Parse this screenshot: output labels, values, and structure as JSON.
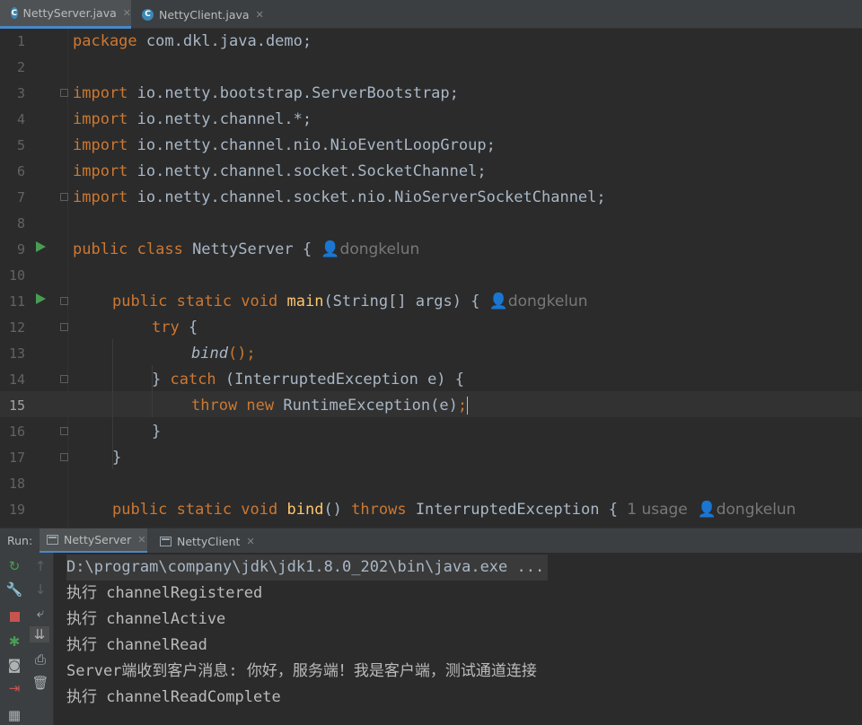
{
  "editor_tabs": [
    {
      "label": "NettyServer.java",
      "icon": "java-class-icon",
      "active": true
    },
    {
      "label": "NettyClient.java",
      "icon": "java-class-icon",
      "active": false
    }
  ],
  "code": {
    "current_line": 15,
    "lines": [
      {
        "n": "1"
      },
      {
        "n": "2"
      },
      {
        "n": "3"
      },
      {
        "n": "4"
      },
      {
        "n": "5"
      },
      {
        "n": "6"
      },
      {
        "n": "7"
      },
      {
        "n": "8"
      },
      {
        "n": "9"
      },
      {
        "n": "10"
      },
      {
        "n": "11"
      },
      {
        "n": "12"
      },
      {
        "n": "13"
      },
      {
        "n": "14"
      },
      {
        "n": "15"
      },
      {
        "n": "16"
      },
      {
        "n": "17"
      },
      {
        "n": "18"
      },
      {
        "n": "19"
      }
    ],
    "l1_kw": "package",
    "l1_rest": " com.dkl.java.demo;",
    "import_kw": "import",
    "imports": [
      " io.netty.bootstrap.ServerBootstrap;",
      " io.netty.channel.*;",
      " io.netty.channel.nio.NioEventLoopGroup;",
      " io.netty.channel.socket.SocketChannel;",
      " io.netty.channel.socket.nio.NioServerSocketChannel;"
    ],
    "l9_kw": "public class",
    "l9_rest": " NettyServer { ",
    "author": "dongkelun",
    "l11_kw": "public static void",
    "l11_fn": "main",
    "l11_rest": "(String[] args) { ",
    "l12_kw": "try",
    "l12_rest": " {",
    "l13_fn": "bind",
    "l13_rest": "();",
    "l14_a": "} ",
    "l14_kw": "catch",
    "l14_rest": " (InterruptedException e) {",
    "l15_kw": "throw new",
    "l15_rest": " RuntimeException(e)",
    "l15_semi": ";",
    "l16": "}",
    "l17": "}",
    "l19_kw": "public static void",
    "l19_fn": "bind",
    "l19_rest": "() ",
    "l19_kw2": "throws",
    "l19_rest2": " InterruptedException { ",
    "l19_usage": "1 usage"
  },
  "run_panel": {
    "label": "Run:",
    "tabs": [
      {
        "label": "NettyServer",
        "active": true
      },
      {
        "label": "NettyClient",
        "active": false
      }
    ],
    "console": [
      "D:\\program\\company\\jdk\\jdk1.8.0_202\\bin\\java.exe ...",
      "执行 channelRegistered",
      "执行 channelActive",
      "执行 channelRead",
      "Server端收到客户消息: 你好，服务端！我是客户端，测试通道连接",
      "执行 channelReadComplete"
    ]
  },
  "icons": {
    "run": "run-gutter-icon",
    "rerun": "rerun-icon",
    "wrench": "wrench-icon",
    "stop": "stop-icon",
    "debug": "debug-icon",
    "camera": "camera-icon",
    "exit": "exit-icon",
    "layout": "layout-icon",
    "up": "up-arrow-icon",
    "down": "down-arrow-icon",
    "wrap": "soft-wrap-icon",
    "scroll": "scroll-to-end-icon",
    "print": "print-icon",
    "trash": "trash-icon"
  },
  "colors": {
    "background": "#2b2b2b",
    "keyword": "#cc7832",
    "function": "#ffc66d",
    "text": "#a9b7c6",
    "accent": "#4a88c7",
    "run_green": "#499c54",
    "stop_red": "#c75450"
  }
}
